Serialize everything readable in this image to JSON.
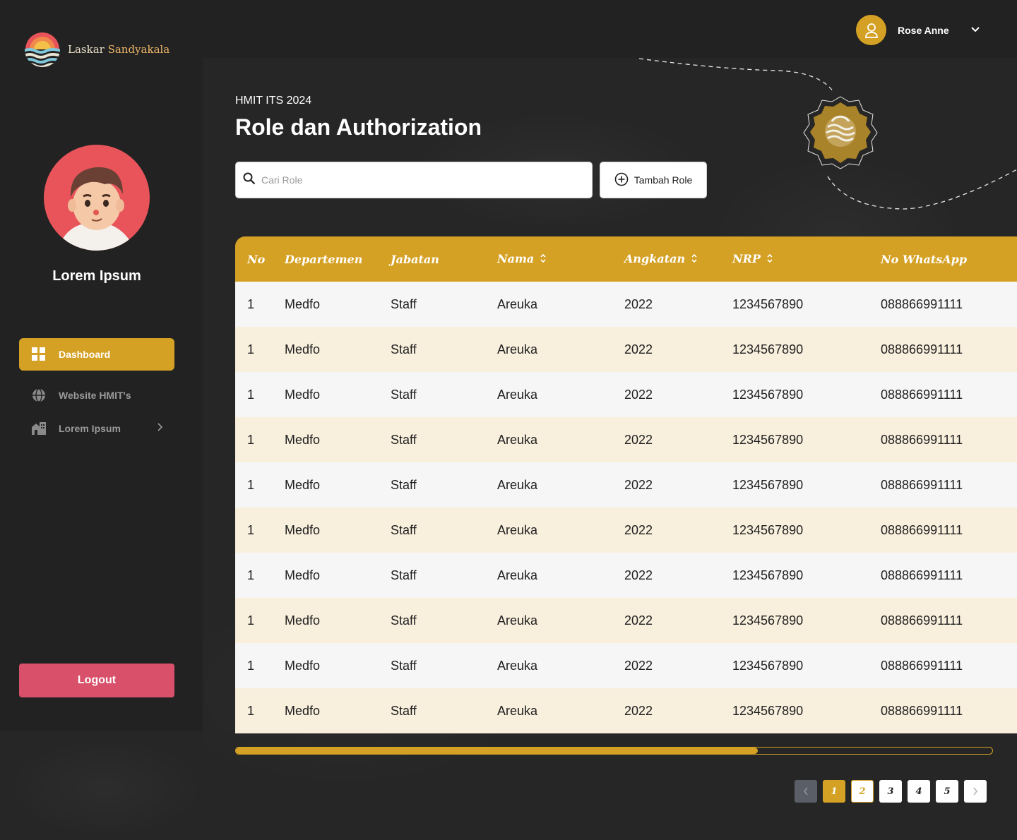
{
  "brand": {
    "name_part1": "Laskar ",
    "name_part2": "Sandyakala"
  },
  "profile": {
    "name": "Lorem Ipsum"
  },
  "nav": {
    "items": [
      {
        "label": "Dashboard",
        "icon": "grid-icon",
        "active": true
      },
      {
        "label": "Website HMIT's",
        "icon": "globe-icon",
        "active": false
      },
      {
        "label": "Lorem Ipsum",
        "icon": "buildings-icon",
        "active": false
      }
    ]
  },
  "logout_label": "Logout",
  "user": {
    "name": "Rose Anne"
  },
  "header": {
    "subtitle": "HMIT ITS 2024",
    "title": "Role dan Authorization"
  },
  "search": {
    "placeholder": "Cari Role",
    "value": ""
  },
  "add_button_label": "Tambah Role",
  "table": {
    "columns": [
      "No",
      "Departemen",
      "Jabatan",
      "Nama",
      "Angkatan",
      "NRP",
      "No WhatsApp"
    ],
    "rows": [
      [
        "1",
        "Medfo",
        "Staff",
        "Areuka",
        "2022",
        "1234567890",
        "088866991111"
      ],
      [
        "1",
        "Medfo",
        "Staff",
        "Areuka",
        "2022",
        "1234567890",
        "088866991111"
      ],
      [
        "1",
        "Medfo",
        "Staff",
        "Areuka",
        "2022",
        "1234567890",
        "088866991111"
      ],
      [
        "1",
        "Medfo",
        "Staff",
        "Areuka",
        "2022",
        "1234567890",
        "088866991111"
      ],
      [
        "1",
        "Medfo",
        "Staff",
        "Areuka",
        "2022",
        "1234567890",
        "088866991111"
      ],
      [
        "1",
        "Medfo",
        "Staff",
        "Areuka",
        "2022",
        "1234567890",
        "088866991111"
      ],
      [
        "1",
        "Medfo",
        "Staff",
        "Areuka",
        "2022",
        "1234567890",
        "088866991111"
      ],
      [
        "1",
        "Medfo",
        "Staff",
        "Areuka",
        "2022",
        "1234567890",
        "088866991111"
      ],
      [
        "1",
        "Medfo",
        "Staff",
        "Areuka",
        "2022",
        "1234567890",
        "088866991111"
      ],
      [
        "1",
        "Medfo",
        "Staff",
        "Areuka",
        "2022",
        "1234567890",
        "088866991111"
      ]
    ]
  },
  "scroll_progress": 0.69,
  "pagination": {
    "pages": [
      "1",
      "2",
      "3",
      "4",
      "5"
    ],
    "current": "1"
  },
  "colors": {
    "accent": "#d4a124",
    "logout": "#d9506a",
    "background": "#222222"
  }
}
